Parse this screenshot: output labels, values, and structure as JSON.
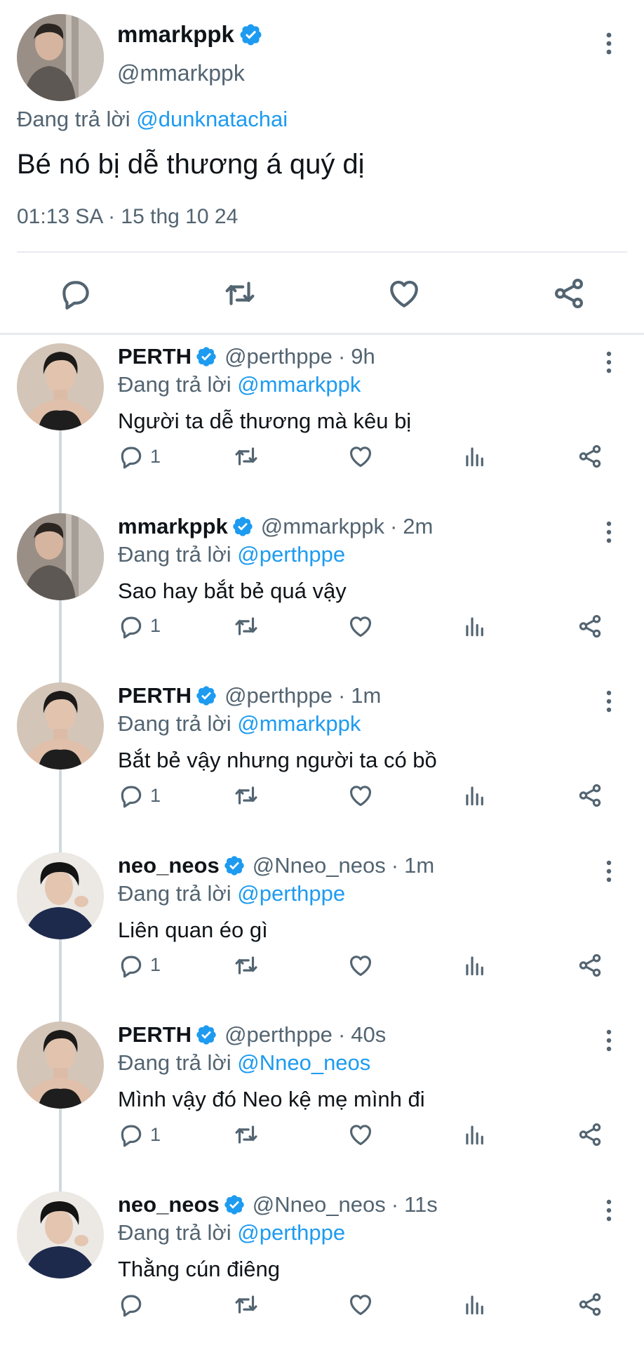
{
  "colors": {
    "primary_text": "#0f1419",
    "secondary_text": "#536471",
    "link": "#1d9bf0",
    "verified": "#1d9bf0",
    "divider": "#e7eaed",
    "thread_line": "#cfd9de"
  },
  "main_tweet": {
    "display_name": "mmarkppk",
    "handle": "@mmarkppk",
    "replying_prefix": "Đang trả lời",
    "replying_to": "@dunknatachai",
    "text": "Bé nó bị dễ thương á quý dị",
    "timestamp": "01:13 SA · 15 thg 10 24",
    "actions": [
      "reply-icon",
      "retweet-icon",
      "like-icon",
      "share-icon"
    ]
  },
  "replies": [
    {
      "display_name": "PERTH",
      "handle": "@perthppe",
      "dot": "·",
      "time_ago": "9h",
      "replying_prefix": "Đang trả lời",
      "replying_to": "@mmarkppk",
      "text": "Người ta dễ thương mà kêu bị",
      "reply_count": "1",
      "avatar": "perth"
    },
    {
      "display_name": "mmarkppk",
      "handle": "@mmarkppk",
      "dot": "·",
      "time_ago": "2m",
      "replying_prefix": "Đang trả lời",
      "replying_to": "@perthppe",
      "text": "Sao hay bắt bẻ quá vậy",
      "reply_count": "1",
      "avatar": "mark"
    },
    {
      "display_name": "PERTH",
      "handle": "@perthppe",
      "dot": "·",
      "time_ago": "1m",
      "replying_prefix": "Đang trả lời",
      "replying_to": "@mmarkppk",
      "text": "Bắt bẻ vậy nhưng người ta có bồ",
      "reply_count": "1",
      "avatar": "perth"
    },
    {
      "display_name": "neo_neos",
      "handle": "@Nneo_neos",
      "dot": "·",
      "time_ago": "1m",
      "replying_prefix": "Đang trả lời",
      "replying_to": "@perthppe",
      "text": "Liên quan éo gì",
      "reply_count": "1",
      "avatar": "neo"
    },
    {
      "display_name": "PERTH",
      "handle": "@perthppe",
      "dot": "·",
      "time_ago": "40s",
      "replying_prefix": "Đang trả lời",
      "replying_to": "@Nneo_neos",
      "text": "Mình vậy đó Neo kệ mẹ mình đi",
      "reply_count": "1",
      "avatar": "perth"
    },
    {
      "display_name": "neo_neos",
      "handle": "@Nneo_neos",
      "dot": "·",
      "time_ago": "11s",
      "replying_prefix": "Đang trả lời",
      "replying_to": "@perthppe",
      "text": "Thằng cún điêng",
      "reply_count": "",
      "avatar": "neo"
    }
  ]
}
